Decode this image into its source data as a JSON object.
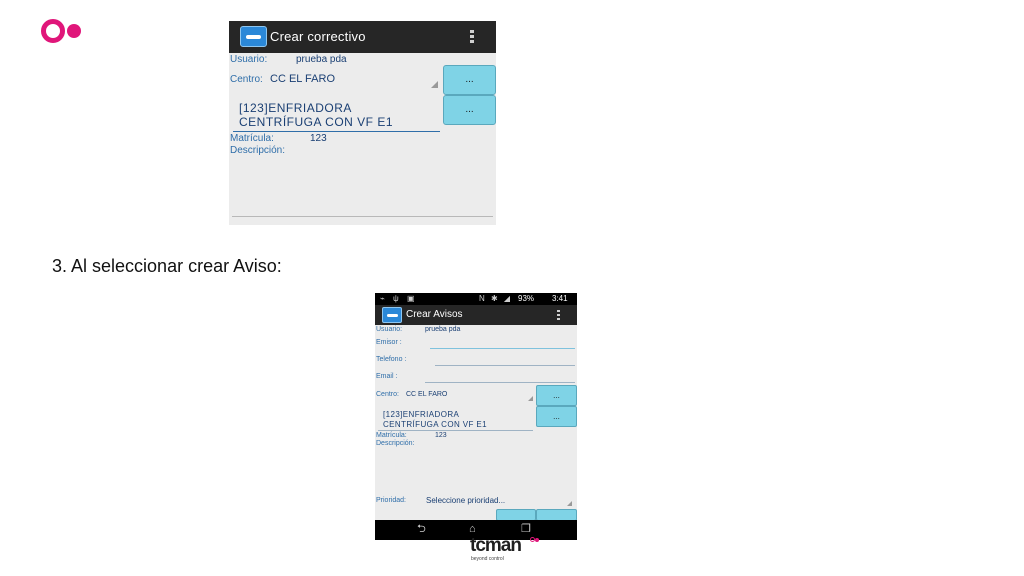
{
  "slide": {
    "caption": "3. Al seleccionar crear Aviso:",
    "brand": {
      "name": "tcman",
      "tagline": "beyond control"
    }
  },
  "screen1": {
    "title": "Crear correctivo",
    "usuario_label": "Usuario:",
    "usuario_value": "prueba pda",
    "centro_label": "Centro:",
    "centro_value": "CC EL FARO",
    "button_label": "...",
    "maquina_line1": "[123]ENFRIADORA",
    "maquina_line2": "CENTRÍFUGA CON VF E1",
    "matricula_label": "Matrícula:",
    "matricula_value": "123",
    "descripcion_label": "Descripción:"
  },
  "screen2": {
    "status": {
      "battery": "93%",
      "time": "3:41",
      "left_icons": "⌁ ψ ▣",
      "right_icons": "N ✱ ◢"
    },
    "title": "Crear Avisos",
    "usuario_label": "Usuario:",
    "usuario_value": "prueba pda",
    "emisor_label": "Emisor :",
    "telefono_label": "Telefono :",
    "email_label": "Email :",
    "centro_label": "Centro:",
    "centro_value": "CC EL FARO",
    "button_label": "...",
    "maquina_line1": "[123]ENFRIADORA",
    "maquina_line2": "CENTRÍFUGA CON VF E1",
    "matricula_label": "Matrícula:",
    "matricula_value": "123",
    "descripcion_label": "Descripción:",
    "prioridad_label": "Prioridad:",
    "prioridad_value": "Seleccione prioridad..."
  },
  "colors": {
    "accent": "#e0167a",
    "button": "#7fd3e6",
    "label": "#2f6ea9",
    "actionbar": "#262626"
  },
  "icons": [
    "back-icon",
    "home-icon",
    "recents-icon",
    "overflow-menu-icon",
    "app-icon"
  ]
}
